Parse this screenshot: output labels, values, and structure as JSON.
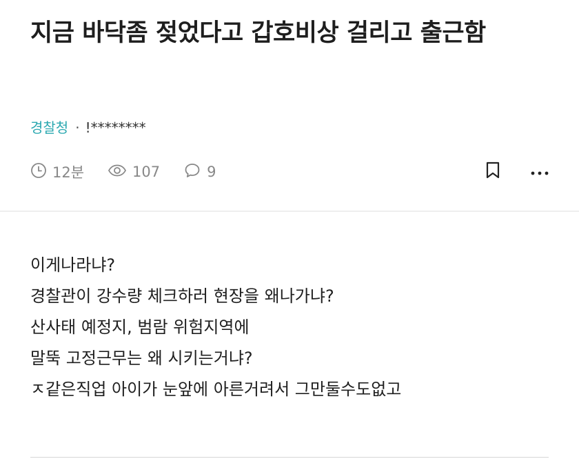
{
  "post": {
    "title": "지금 바닥좀 젖었다고 갑호비상 걸리고 출근함",
    "board": "경찰청",
    "separator": "·",
    "author": "!********",
    "stats": {
      "time": "12분",
      "views": "107",
      "comments": "9"
    },
    "body_lines": [
      "이게나라냐?",
      "경찰관이 강수량 체크하러 현장을 왜나가냐?",
      "산사태 예정지, 범람 위험지역에",
      "말뚝 고정근무는 왜 시키는거냐?",
      "ㅈ같은직업 아이가 눈앞에 아른거려서 그만둘수도없고"
    ]
  },
  "icons": {
    "time": "clock-icon",
    "views": "eye-icon",
    "comments": "speech-bubble-icon",
    "bookmark": "bookmark-icon",
    "more": "more-dots-icon"
  },
  "colors": {
    "board": "#2aa8b0",
    "meta": "#888888",
    "title": "#1e1e1e"
  }
}
